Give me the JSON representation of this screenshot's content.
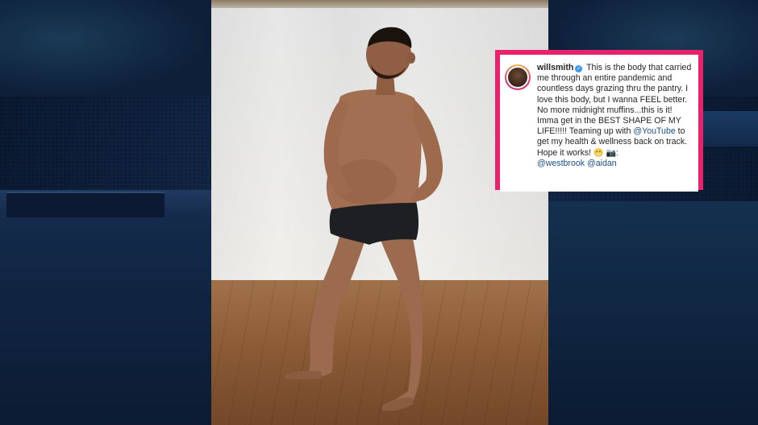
{
  "post": {
    "username": "willsmith",
    "caption_part1": " This is the body that carried me through an entire pandemic and countless days grazing thru the pantry. I love this body, but I wanna FEEL better. No more midnight muffins...this is it! Imma get in the BEST SHAPE OF MY LIFE!!!!! Teaming up with ",
    "mention_youtube": "@YouTube",
    "caption_part2": " to get my health & wellness back on track. Hope it works! ",
    "emoji_grimace": "😬",
    "emoji_camera": "📷",
    "photo_credit_sep": ": ",
    "mention_westbrook": "@westbrook",
    "mention_aidan": "@aidan"
  },
  "colors": {
    "frame_accent": "#e8236b",
    "verified_badge": "#3897f0",
    "mention_link": "#1b4f8a",
    "background": "#0f2240"
  },
  "icons": {
    "verified": "verified-check-icon",
    "avatar": "profile-avatar"
  }
}
